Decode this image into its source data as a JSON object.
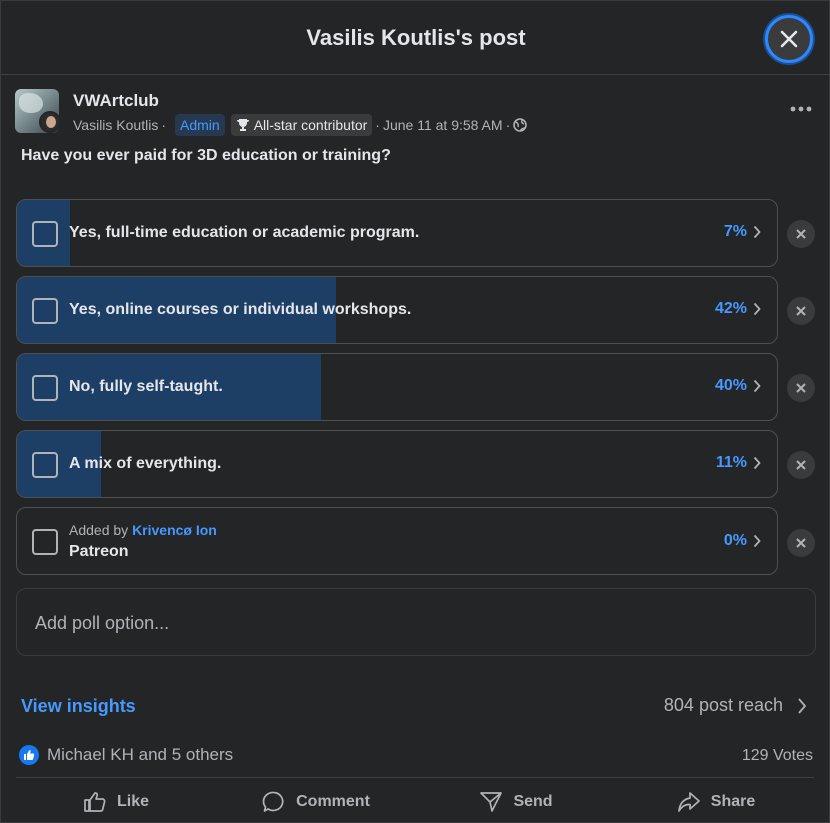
{
  "header": {
    "title": "Vasilis Koutlis's post"
  },
  "post": {
    "group_name": "VWArtclub",
    "author_name": "Vasilis Koutlis",
    "admin_badge": "Admin",
    "contributor_badge": "All-star contributor",
    "timestamp": "June 11 at 9:58 AM",
    "question": "Have you ever paid for 3D education or training?"
  },
  "poll": {
    "options": [
      {
        "label": "Yes, full-time education or academic program.",
        "percent_text": "7%",
        "percent": 7
      },
      {
        "label": "Yes, online courses or individual workshops.",
        "percent_text": "42%",
        "percent": 42
      },
      {
        "label": "No, fully self-taught.",
        "percent_text": "40%",
        "percent": 40
      },
      {
        "label": "A mix of everything.",
        "percent_text": "11%",
        "percent": 11
      }
    ],
    "added_option": {
      "added_by_prefix": "Added by",
      "added_by_name": "Krivencø Ion",
      "label": "Patreon",
      "percent_text": "0%",
      "percent": 0
    },
    "add_placeholder": "Add poll option..."
  },
  "insights": {
    "link": "View insights",
    "reach": "804 post reach"
  },
  "footer": {
    "reactions_text": "Michael KH and 5 others",
    "votes": "129 Votes",
    "actions": {
      "like": "Like",
      "comment": "Comment",
      "send": "Send",
      "share": "Share"
    }
  },
  "colors": {
    "accent": "#4599ff",
    "bar_fill": "#1d3f66",
    "background": "#242526"
  },
  "icons": [
    "close-icon",
    "more-icon",
    "trophy-icon",
    "globe-icon",
    "chevron-right-icon",
    "remove-icon",
    "like-icon",
    "comment-icon",
    "send-icon",
    "share-icon"
  ]
}
